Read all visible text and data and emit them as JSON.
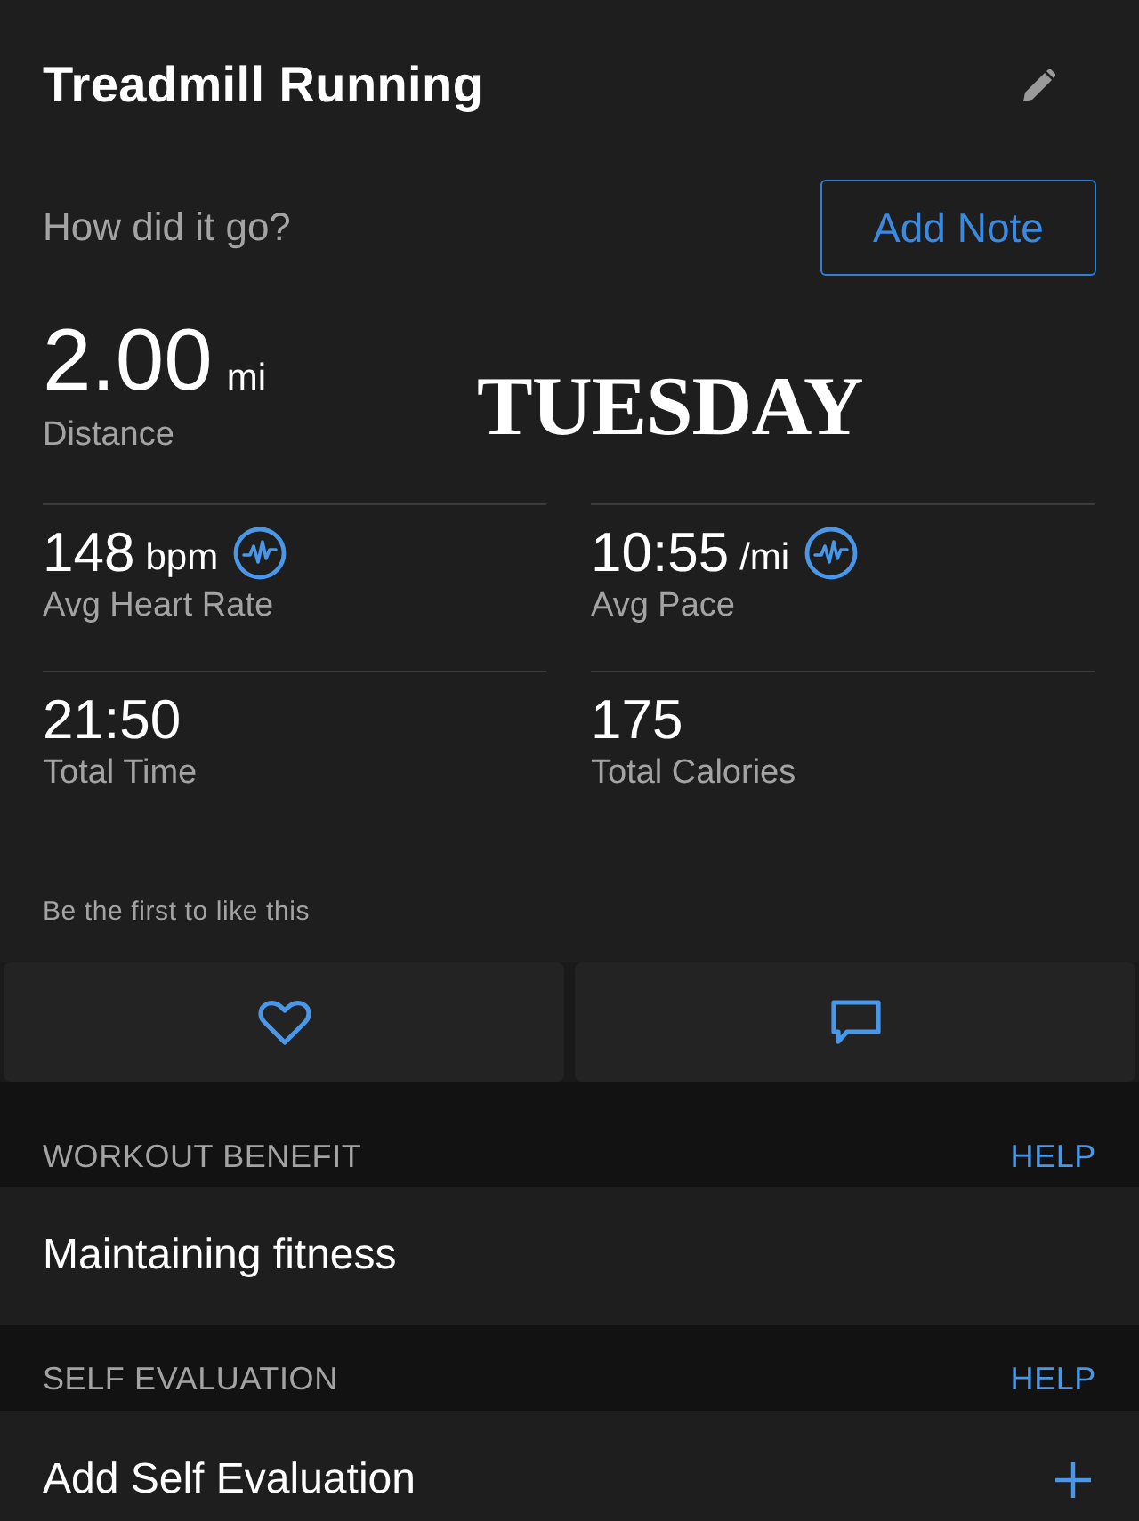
{
  "header": {
    "title": "Treadmill Running"
  },
  "note_prompt": {
    "text": "How did it go?",
    "button": "Add Note"
  },
  "overlay_caption": "TUESDAY",
  "primary_stat": {
    "value": "2.00",
    "unit": "mi",
    "label": "Distance"
  },
  "stats": [
    {
      "value": "148",
      "unit": "bpm",
      "label": "Avg Heart Rate",
      "has_graph": true
    },
    {
      "value": "10:55",
      "unit": "/mi",
      "label": "Avg Pace",
      "has_graph": true
    },
    {
      "value": "21:50",
      "label": "Total Time",
      "has_graph": false
    },
    {
      "value": "175",
      "label": "Total Calories",
      "has_graph": false
    }
  ],
  "likes": {
    "text": "Be the first to like this"
  },
  "actions": [
    {
      "kind": "like"
    },
    {
      "kind": "comment"
    }
  ],
  "sections": [
    {
      "heading": "WORKOUT BENEFIT",
      "help": "HELP",
      "row": {
        "kind": "text",
        "label": "Maintaining fitness"
      }
    },
    {
      "heading": "SELF EVALUATION",
      "help": "HELP",
      "row": {
        "kind": "add",
        "label": "Add Self Evaluation"
      }
    }
  ]
}
